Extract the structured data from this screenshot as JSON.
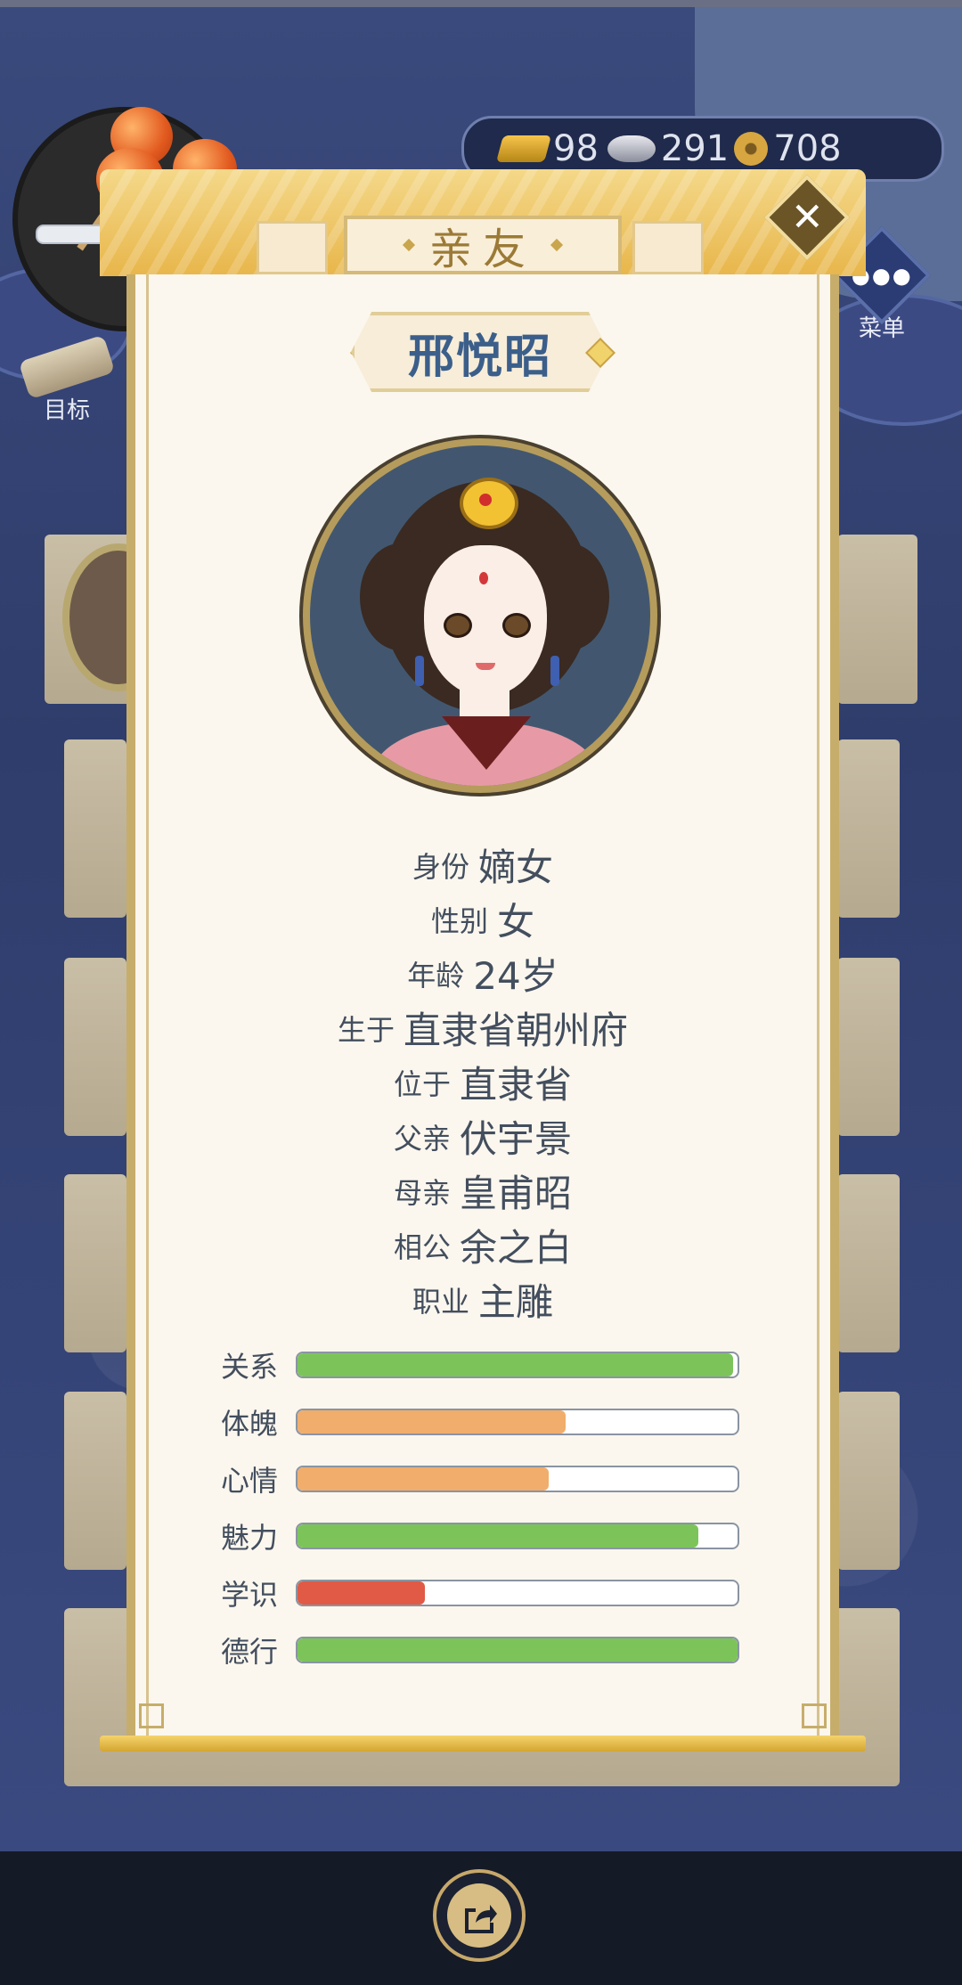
{
  "header": {
    "currency": [
      {
        "icon": "gold-ingot-icon",
        "value": "98"
      },
      {
        "icon": "silver-ingot-icon",
        "value": "291"
      },
      {
        "icon": "coin-icon",
        "value": "708"
      }
    ],
    "goal_label": "目标",
    "menu_label": "菜单"
  },
  "dialog": {
    "title": "亲友",
    "close_symbol": "✕"
  },
  "profile": {
    "name": "邢悦昭",
    "details": [
      {
        "label": "身份",
        "value": "嫡女"
      },
      {
        "label": "性别",
        "value": "女"
      },
      {
        "label": "年龄",
        "value": "24岁"
      },
      {
        "label": "生于",
        "value": "直隶省朝州府"
      },
      {
        "label": "位于",
        "value": "直隶省"
      },
      {
        "label": "父亲",
        "value": "伏宇景"
      },
      {
        "label": "母亲",
        "value": "皇甫昭"
      },
      {
        "label": "相公",
        "value": "余之白"
      },
      {
        "label": "职业",
        "value": "主雕"
      }
    ],
    "stats": [
      {
        "label": "关系",
        "fraction": 0.99,
        "color": "#7cc45a"
      },
      {
        "label": "体魄",
        "fraction": 0.61,
        "color": "#f0ad6c"
      },
      {
        "label": "心情",
        "fraction": 0.57,
        "color": "#f0ad6c"
      },
      {
        "label": "魅力",
        "fraction": 0.91,
        "color": "#7cc45a"
      },
      {
        "label": "学识",
        "fraction": 0.29,
        "color": "#e05a45"
      },
      {
        "label": "德行",
        "fraction": 1.0,
        "color": "#7cc45a"
      }
    ]
  },
  "footer": {
    "share_icon": "share-icon"
  }
}
